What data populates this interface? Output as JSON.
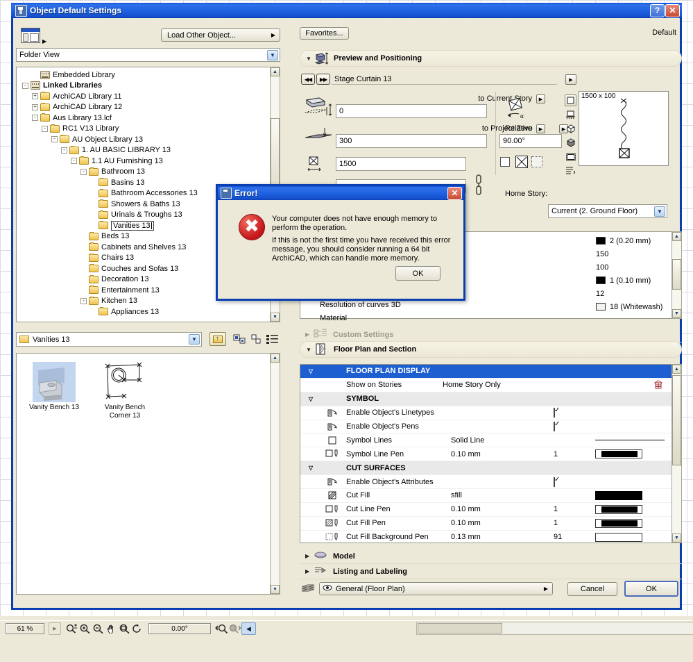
{
  "window": {
    "title": "Object Default Settings",
    "help_button": "?",
    "close_button": "✕"
  },
  "left_panel": {
    "layout_icon": "window-layout-icon",
    "load_other_object": "Load Other Object...",
    "view_mode": "Folder View",
    "tree": [
      {
        "indent": 1,
        "expander": "",
        "icon": "library",
        "label": "Embedded Library",
        "bold": false,
        "selected": false
      },
      {
        "indent": 0,
        "expander": "-",
        "icon": "library",
        "label": "Linked Libraries",
        "bold": true,
        "selected": false
      },
      {
        "indent": 1,
        "expander": "+",
        "icon": "folder",
        "label": "ArchiCAD Library 11",
        "bold": false,
        "selected": false
      },
      {
        "indent": 1,
        "expander": "+",
        "icon": "folder",
        "label": "ArchiCAD Library 12",
        "bold": false,
        "selected": false
      },
      {
        "indent": 1,
        "expander": "-",
        "icon": "folder",
        "label": "Aus Library 13.lcf",
        "bold": false,
        "selected": false
      },
      {
        "indent": 2,
        "expander": "-",
        "icon": "folder",
        "label": "RC1 V13 Library",
        "bold": false,
        "selected": false
      },
      {
        "indent": 3,
        "expander": "-",
        "icon": "folder",
        "label": "AU Object Library 13",
        "bold": false,
        "selected": false
      },
      {
        "indent": 4,
        "expander": "-",
        "icon": "folder",
        "label": "1. AU BASIC LIBRARY 13",
        "bold": false,
        "selected": false
      },
      {
        "indent": 5,
        "expander": "-",
        "icon": "folder",
        "label": "1.1 AU Furnishing 13",
        "bold": false,
        "selected": false
      },
      {
        "indent": 6,
        "expander": "-",
        "icon": "folder",
        "label": "Bathroom 13",
        "bold": false,
        "selected": false
      },
      {
        "indent": 7,
        "expander": "",
        "icon": "folder",
        "label": "Basins 13",
        "bold": false,
        "selected": false
      },
      {
        "indent": 7,
        "expander": "",
        "icon": "folder",
        "label": "Bathroom Accessories 13",
        "bold": false,
        "selected": false
      },
      {
        "indent": 7,
        "expander": "",
        "icon": "folder",
        "label": "Showers & Baths 13",
        "bold": false,
        "selected": false
      },
      {
        "indent": 7,
        "expander": "",
        "icon": "folder",
        "label": "Urinals & Troughs 13",
        "bold": false,
        "selected": false
      },
      {
        "indent": 7,
        "expander": "",
        "icon": "folder",
        "label": "Vanities 13",
        "bold": false,
        "selected": true
      },
      {
        "indent": 6,
        "expander": "",
        "icon": "folder",
        "label": "Beds 13",
        "bold": false,
        "selected": false
      },
      {
        "indent": 6,
        "expander": "",
        "icon": "folder",
        "label": "Cabinets and Shelves 13",
        "bold": false,
        "selected": false
      },
      {
        "indent": 6,
        "expander": "",
        "icon": "folder",
        "label": "Chairs 13",
        "bold": false,
        "selected": false
      },
      {
        "indent": 6,
        "expander": "",
        "icon": "folder",
        "label": "Couches and Sofas 13",
        "bold": false,
        "selected": false
      },
      {
        "indent": 6,
        "expander": "",
        "icon": "folder",
        "label": "Decoration 13",
        "bold": false,
        "selected": false
      },
      {
        "indent": 6,
        "expander": "",
        "icon": "folder",
        "label": "Entertainment 13",
        "bold": false,
        "selected": false
      },
      {
        "indent": 6,
        "expander": "-",
        "icon": "folder",
        "label": "Kitchen 13",
        "bold": false,
        "selected": false
      },
      {
        "indent": 7,
        "expander": "",
        "icon": "folder",
        "label": "Appliances 13",
        "bold": false,
        "selected": false
      }
    ],
    "browser": {
      "current_folder": "Vanities 13",
      "toolbar_icons": [
        "up-one-level-icon",
        "large-icons-view-icon",
        "small-icons-view-icon",
        "list-view-icon"
      ],
      "objects": [
        {
          "name": "Vanity Bench 13",
          "selected": true,
          "thumb": "3d-vanity-bench-preview"
        },
        {
          "name": "Vanity Bench\nCorner 13",
          "name_line1": "Vanity Bench",
          "name_line2": "Corner 13",
          "selected": false,
          "thumb": "2d-symbol-corner-bench"
        }
      ]
    }
  },
  "right_panel": {
    "favorites_button": "Favorites...",
    "default_label": "Default",
    "preview_section": {
      "title": "Preview and Positioning",
      "object_name": "Stage Curtain 13",
      "prev_button": "◀◀",
      "next_button": "▶▶",
      "to_current_story_label": "to Current Story",
      "to_current_story_value": "0",
      "to_project_zero_label": "to Project Zero",
      "to_project_zero_value": "300",
      "width_value": "1500",
      "relative_label": "Relative",
      "angle_value": "90.00°",
      "home_story_label": "Home Story:",
      "home_story_value": "Current (2. Ground Floor)",
      "preview_dimensions": "1500 x 100",
      "view_modes": [
        "2d-symbol-view-icon",
        "front-view-icon",
        "3d-wireframe-icon",
        "3d-shaded-icon",
        "3d-perspective-icon",
        "list-params-icon"
      ]
    },
    "parameters": {
      "rows": [
        {
          "label": "Resolution of curves 3D",
          "value": "12",
          "swatch": null
        },
        {
          "label": "Material",
          "value": "18 (Whitewash)",
          "swatch": "#f2f2ee"
        }
      ],
      "pen_values": [
        {
          "value": "2 (0.20 mm)",
          "swatch": "#000000"
        },
        {
          "value": "150",
          "swatch": null
        },
        {
          "value": "100",
          "swatch": null
        },
        {
          "value": "1 (0.10 mm)",
          "swatch": "#000000"
        },
        {
          "value": "12",
          "swatch": null
        },
        {
          "value": "18 (Whitewash)",
          "swatch": "#f2f2ee"
        }
      ]
    },
    "custom_settings_section": {
      "title": "Custom Settings"
    },
    "floor_plan_section": {
      "title": "Floor Plan and Section",
      "rows": [
        {
          "type": "group",
          "selected": true,
          "label": "FLOOR PLAN DISPLAY",
          "value": "",
          "pen": "",
          "swatch": ""
        },
        {
          "type": "item",
          "icon": "",
          "label": "Show on Stories",
          "value": "Home Story Only",
          "pen": "",
          "swatch": "stories-icon"
        },
        {
          "type": "group",
          "selected": false,
          "label": "SYMBOL",
          "value": "",
          "pen": "",
          "swatch": ""
        },
        {
          "type": "item",
          "icon": "pen-object-icon",
          "label": "Enable Object's Linetypes",
          "value": "",
          "pen": "checkbox",
          "swatch": ""
        },
        {
          "type": "item",
          "icon": "pen-object-icon",
          "label": "Enable Object's Pens",
          "value": "",
          "pen": "checkbox",
          "swatch": ""
        },
        {
          "type": "item",
          "icon": "line-square-icon",
          "label": "Symbol Lines",
          "value": "Solid Line",
          "pen": "",
          "swatch": "solid-line"
        },
        {
          "type": "item",
          "icon": "pen-square-icon",
          "label": "Symbol Line Pen",
          "value": "0.10 mm",
          "pen": "1",
          "swatch": "pen-chip"
        },
        {
          "type": "group",
          "selected": false,
          "label": "CUT SURFACES",
          "value": "",
          "pen": "",
          "swatch": ""
        },
        {
          "type": "item",
          "icon": "pen-object-icon",
          "label": "Enable Object's Attributes",
          "value": "",
          "pen": "checkbox",
          "swatch": ""
        },
        {
          "type": "item",
          "icon": "hatch-icon",
          "label": "Cut Fill",
          "value": "sfill",
          "pen": "",
          "swatch": "black-fill"
        },
        {
          "type": "item",
          "icon": "pen-square-icon",
          "label": "Cut Line Pen",
          "value": "0.10 mm",
          "pen": "1",
          "swatch": "pen-chip"
        },
        {
          "type": "item",
          "icon": "hatch-pen-icon",
          "label": "Cut Fill Pen",
          "value": "0.10 mm",
          "pen": "1",
          "swatch": "pen-chip"
        },
        {
          "type": "item",
          "icon": "dotted-pen-icon",
          "label": "Cut Fill Background Pen",
          "value": "0.13 mm",
          "pen": "91",
          "swatch": "white-chip"
        }
      ]
    },
    "model_section": {
      "title": "Model"
    },
    "listing_section": {
      "title": "Listing and Labeling"
    },
    "footer": {
      "view_combo": "General (Floor Plan)",
      "cancel_button": "Cancel",
      "ok_button": "OK"
    }
  },
  "error_dialog": {
    "title": "Error!",
    "close_button": "✕",
    "icon": "error-cross-icon",
    "paragraph1": "Your computer does not have enough memory to perform the operation.",
    "paragraph2": "If this is not the first time you have received this error message, you should consider running a 64 bit ArchiCAD, which can handle more memory.",
    "ok_button": "OK"
  },
  "status_bar": {
    "zoom_level": "61 %",
    "angle": "0.00°",
    "icons": [
      "zoom-plus-minus-icon",
      "zoom-in-icon",
      "zoom-out-icon",
      "pan-hand-icon",
      "fit-in-window-icon",
      "orbit-icon",
      "prev-zoom-icon",
      "next-zoom-icon",
      "collapse-icon"
    ]
  },
  "colors": {
    "title_blue": "#1d5fd0",
    "dialog_bg": "#ece9d8",
    "selection_blue": "#1d5fd0",
    "error_red": "#c4151b"
  }
}
